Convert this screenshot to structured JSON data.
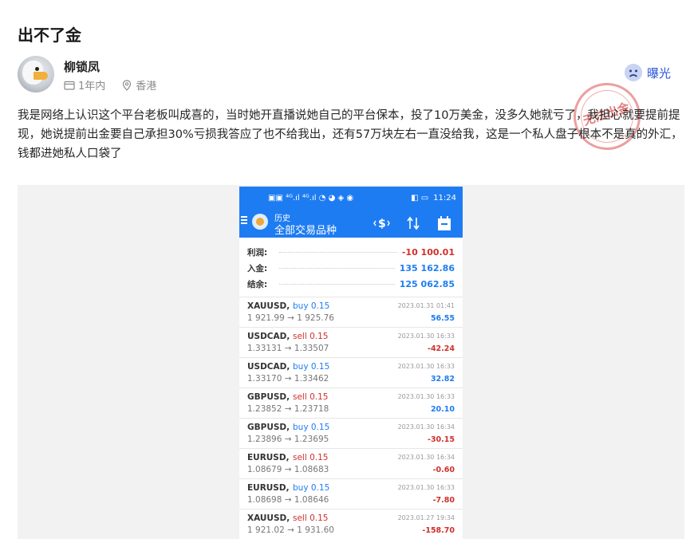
{
  "post": {
    "title": "出不了金",
    "author": "柳锁凤",
    "time": "1年内",
    "location": "香港",
    "expose_label": "曝光",
    "stamp_text": "无法出金",
    "body": "我是网络上认识这个平台老板叫成喜的，当时她开直播说她自己的平台保本，投了10万美金，没多久她就亏了，我担心就要提前提现，她说提前出金要自己承担30%亏损我答应了也不给我出，还有57万块左右一直没给我，这是一个私人盘子根本不是真的外汇，钱都进她私人口袋了"
  },
  "phone": {
    "status_time": "11:24",
    "status_left": "▣▣ ⁴ᴳ.ıl ⁴ᴳ.ıl ◔ ◕ ◈ ◉",
    "status_right": "◧ ▭",
    "header_sub": "历史",
    "header_main": "全部交易品种",
    "summary": [
      {
        "label": "利润:",
        "value": "-10 100.01",
        "color": "#d0302b"
      },
      {
        "label": "入金:",
        "value": "135 162.86",
        "color": "#1e7cf2"
      },
      {
        "label": "结余:",
        "value": "125 062.85",
        "color": "#1e7cf2"
      }
    ],
    "trades": [
      {
        "symbol": "XAUUSD,",
        "side": "buy 0.15",
        "side_color": "#1e7cf2",
        "price": "1 921.99 → 1 925.76",
        "time": "2023.01.31 01:41",
        "pl": "56.55",
        "pl_color": "#1e7cf2"
      },
      {
        "symbol": "USDCAD,",
        "side": "sell 0.15",
        "side_color": "#d0302b",
        "price": "1.33131 → 1.33507",
        "time": "2023.01.30 16:33",
        "pl": "-42.24",
        "pl_color": "#d0302b"
      },
      {
        "symbol": "USDCAD,",
        "side": "buy 0.15",
        "side_color": "#1e7cf2",
        "price": "1.33170 → 1.33462",
        "time": "2023.01.30 16:33",
        "pl": "32.82",
        "pl_color": "#1e7cf2"
      },
      {
        "symbol": "GBPUSD,",
        "side": "sell 0.15",
        "side_color": "#d0302b",
        "price": "1.23852 → 1.23718",
        "time": "2023.01.30 16:33",
        "pl": "20.10",
        "pl_color": "#1e7cf2"
      },
      {
        "symbol": "GBPUSD,",
        "side": "buy 0.15",
        "side_color": "#1e7cf2",
        "price": "1.23896 → 1.23695",
        "time": "2023.01.30 16:34",
        "pl": "-30.15",
        "pl_color": "#d0302b"
      },
      {
        "symbol": "EURUSD,",
        "side": "sell 0.15",
        "side_color": "#d0302b",
        "price": "1.08679 → 1.08683",
        "time": "2023.01.30 16:34",
        "pl": "-0.60",
        "pl_color": "#d0302b"
      },
      {
        "symbol": "EURUSD,",
        "side": "buy 0.15",
        "side_color": "#1e7cf2",
        "price": "1.08698 → 1.08646",
        "time": "2023.01.30 16:33",
        "pl": "-7.80",
        "pl_color": "#d0302b"
      },
      {
        "symbol": "XAUUSD,",
        "side": "sell 0.15",
        "side_color": "#d0302b",
        "price": "1 921.02 → 1 931.60",
        "time": "2023.01.27 19:34",
        "pl": "-158.70",
        "pl_color": "#d0302b"
      }
    ]
  }
}
